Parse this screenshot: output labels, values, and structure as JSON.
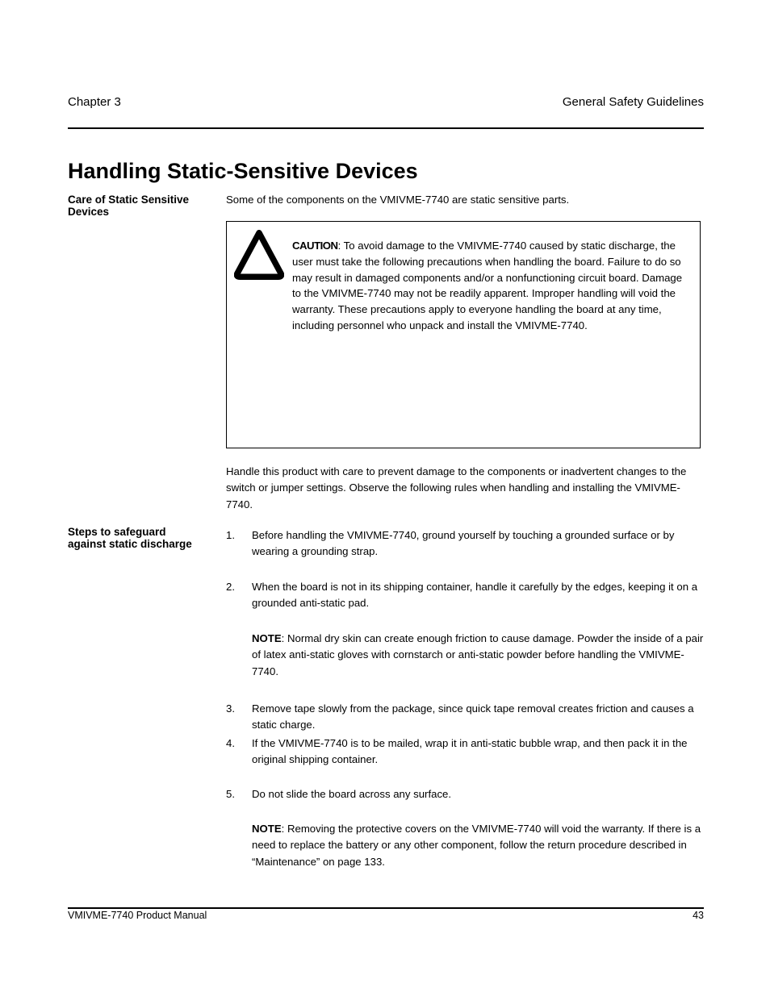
{
  "header": {
    "left": "Chapter 3",
    "right": "General Safety Guidelines"
  },
  "footer": {
    "left": "VMIVME-7740 Product Manual",
    "right": "43"
  },
  "section": {
    "title": "Handling Static-Sensitive Devices",
    "sub1": "Care of Static Sensitive Devices",
    "intro": "Some of the components on the VMIVME-7740 are static sensitive parts.",
    "caution_title": "CAUTION",
    "caution_body": ": To avoid damage to the VMIVME-7740 caused by static discharge, the user must take the following precautions when handling the board. Failure to do so may result in damaged components and/or a nonfunctioning circuit board. Damage to the VMIVME-7740 may not be readily apparent. Improper handling will void the warranty. These precautions apply to everyone handling the board at any time, including personnel who unpack and install the VMIVME-7740.",
    "para1": "Handle this product with care to prevent damage to the components or inadvertent changes to the switch or jumper settings. Observe the following rules when handling and installing the VMIVME-7740.",
    "steps_label": "Steps to safeguard against static discharge",
    "steps": [
      {
        "n": "1.",
        "t": "Before handling the VMIVME-7740, ground yourself by touching a grounded surface or by wearing a grounding strap."
      },
      {
        "n": "2.",
        "t": "When the board is not in its shipping container, handle it carefully by the edges, keeping it on a grounded anti-static pad."
      },
      {
        "n": "3.",
        "t": "Remove tape slowly from the package, since quick tape removal creates friction and causes a static charge."
      },
      {
        "n": "4.",
        "t": "If the VMIVME-7740 is to be mailed, wrap it in anti-static bubble wrap, and then pack it in the original shipping container."
      },
      {
        "n": "5.",
        "t": "Do not slide the board across any surface."
      }
    ],
    "note1_label": "NOTE",
    "note1_body": ": Normal dry skin can create enough friction to cause damage. Powder the inside of a pair of latex anti-static gloves with cornstarch or anti-static powder before handling the VMIVME-7740.",
    "note2_label": "NOTE",
    "note2_body": ": Removing the protective covers on the VMIVME-7740 will void the warranty. If there is a need to replace the battery or any other component, follow the return procedure described in “Maintenance” on page 133."
  }
}
